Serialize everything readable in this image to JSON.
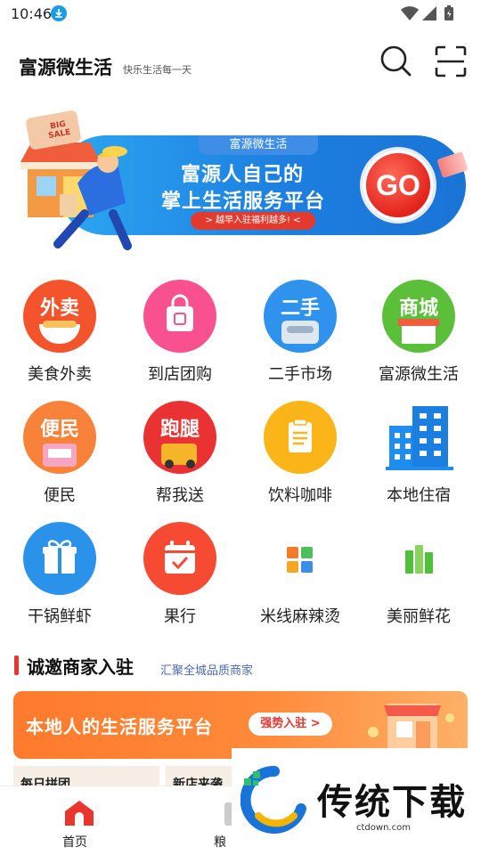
{
  "status": {
    "time": "10:46"
  },
  "header": {
    "title": "富源微生活",
    "subtitle": "快乐生活每一天"
  },
  "banner": {
    "tag": "富源微生活",
    "line1": "富源人自己的",
    "line2": "掌上生活服务平台",
    "small": "> 越早入驻福利越多! <",
    "go": "GO",
    "shop_sign": "BIG SALE"
  },
  "grid": [
    {
      "label": "美食外卖",
      "icon_text": "外卖",
      "icon": "food-delivery-icon",
      "color": "#f4542c"
    },
    {
      "label": "到店团购",
      "icon_text": "",
      "icon": "group-buy-icon",
      "color": "#f9508f"
    },
    {
      "label": "二手市场",
      "icon_text": "二手",
      "icon": "second-hand-icon",
      "color": "#2f93ee"
    },
    {
      "label": "富源微生活",
      "icon_text": "商城",
      "icon": "mall-icon",
      "color": "#5cbf3a"
    },
    {
      "label": "便民",
      "icon_text": "便民",
      "icon": "convenience-icon",
      "color": "#f8823a"
    },
    {
      "label": "帮我送",
      "icon_text": "跑腿",
      "icon": "errand-icon",
      "color": "#ea3232"
    },
    {
      "label": "饮料咖啡",
      "icon_text": "",
      "icon": "clipboard-icon",
      "color": "#fbb518"
    },
    {
      "label": "本地住宿",
      "icon_text": "",
      "icon": "building-icon",
      "color": "#1d8ef0"
    },
    {
      "label": "干锅鲜虾",
      "icon_text": "",
      "icon": "gift-icon",
      "color": "#2b92ea"
    },
    {
      "label": "果行",
      "icon_text": "",
      "icon": "calendar-icon",
      "color": "#f64a32"
    },
    {
      "label": "米线麻辣烫",
      "icon_text": "",
      "icon": "tiles-icon",
      "color": "#f5a623"
    },
    {
      "label": "美丽鲜花",
      "icon_text": "",
      "icon": "books-icon",
      "color": "#4fbf3c"
    }
  ],
  "section": {
    "title": "诚邀商家入驻",
    "subtitle": "汇聚全城品质商家"
  },
  "promo": {
    "text": "本地人的生活服务平台",
    "button": "强势入驻 >"
  },
  "cards": [
    "每日拼团",
    "新店来袭"
  ],
  "nav": {
    "home": "首页",
    "second": "粮"
  },
  "watermark": {
    "text": "传统下载",
    "url": "ctdown.com"
  }
}
